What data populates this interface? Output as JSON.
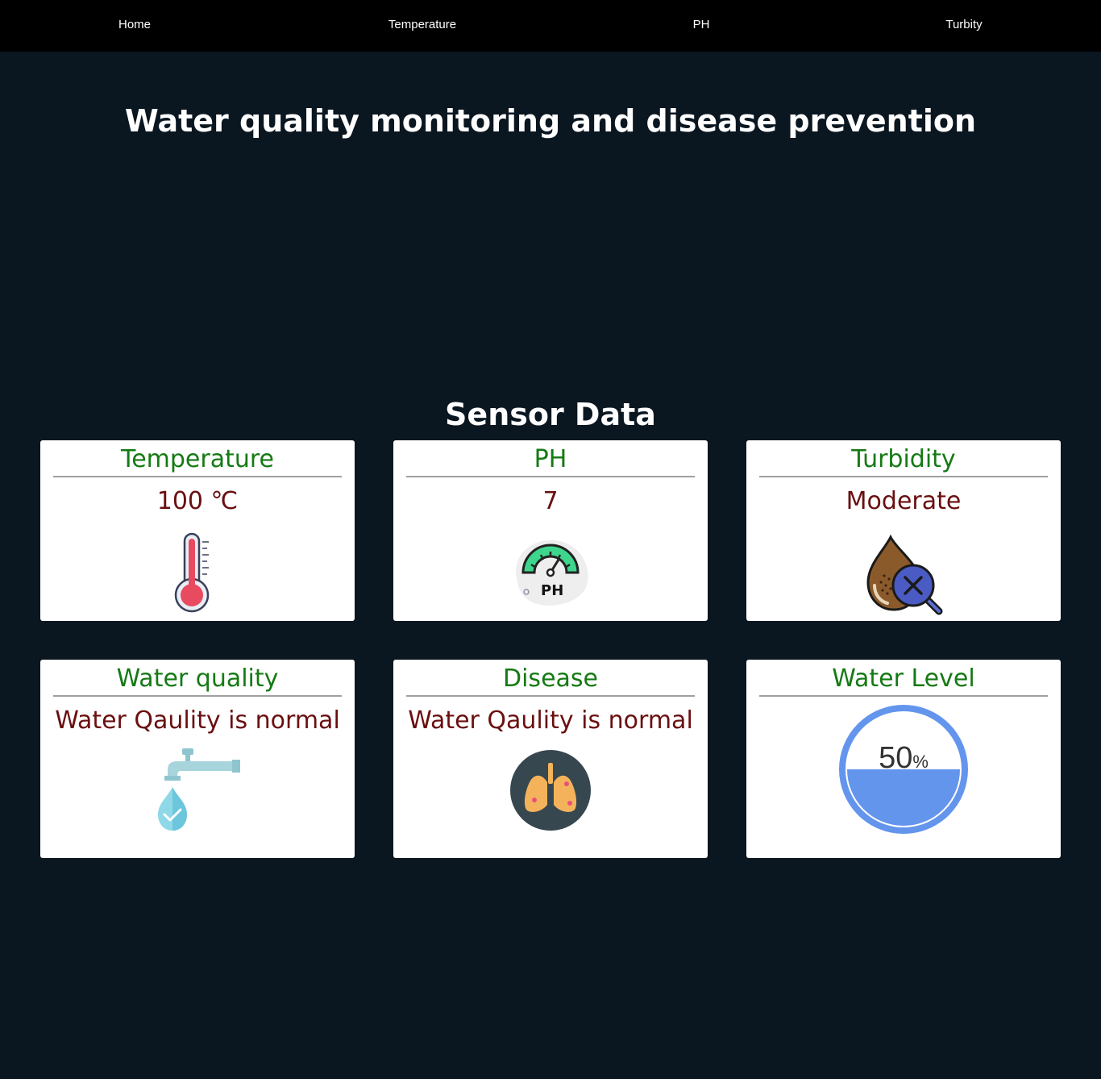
{
  "nav": {
    "items": [
      {
        "label": "Home"
      },
      {
        "label": "Temperature"
      },
      {
        "label": "PH"
      },
      {
        "label": "Turbity"
      }
    ]
  },
  "page": {
    "title": "Water quality monitoring and disease prevention",
    "section_title": "Sensor Data"
  },
  "cards": {
    "temperature": {
      "title": "Temperature",
      "value": "100",
      "unit": "℃",
      "icon": "thermometer-icon"
    },
    "ph": {
      "title": "PH",
      "value": "7",
      "icon": "ph-meter-icon"
    },
    "turbidity": {
      "title": "Turbidity",
      "value": "Moderate",
      "icon": "dirty-water-drop-icon"
    },
    "water_quality": {
      "title": "Water quality",
      "value": "Water Qaulity is normal",
      "icon": "tap-water-drop-icon"
    },
    "disease": {
      "title": "Disease",
      "value": "Water Qaulity is normal",
      "icon": "lungs-icon"
    },
    "water_level": {
      "title": "Water Level",
      "value": "50",
      "unit": "%",
      "level_fraction": 0.5
    }
  },
  "colors": {
    "header_green": "#157a14",
    "value_maroon": "#6a0f10",
    "gauge_blue": "#6495ed",
    "background": "#0a1620"
  }
}
